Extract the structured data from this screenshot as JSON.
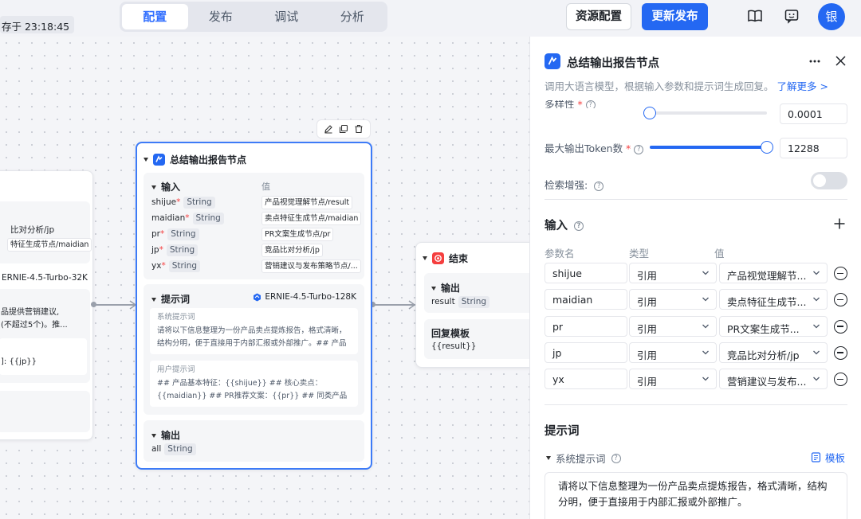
{
  "topbar": {
    "saved_at": "存于 23:18:45",
    "tabs": [
      "配置",
      "发布",
      "调试",
      "分析"
    ],
    "resource_btn": "资源配置",
    "publish_btn": "更新发布",
    "avatar": "银"
  },
  "canvas": {
    "left_node": {
      "lines": [
        "比对分析/jp",
        "特征生成节点/maidian",
        "ERNIE-4.5-Turbo-32K",
        "品提供营销建议,",
        "(不超过5个)。推...",
        "]: {{jp}}"
      ]
    },
    "main_node": {
      "title": "总结输出报告节点",
      "input_title": "输入",
      "value_header": "值",
      "inputs": [
        {
          "name": "shijue",
          "type": "String",
          "value": "产品视觉理解节点/result"
        },
        {
          "name": "maidian",
          "type": "String",
          "value": "卖点特征生成节点/maidian"
        },
        {
          "name": "pr",
          "type": "String",
          "value": "PR文案生成节点/pr"
        },
        {
          "name": "jp",
          "type": "String",
          "value": "竞品比对分析/jp"
        },
        {
          "name": "yx",
          "type": "String",
          "value": "营销建议与发布策略节点/..."
        }
      ],
      "prompt_title": "提示词",
      "model": "ERNIE-4.5-Turbo-128K",
      "system_prompt_label": "系统提示词",
      "system_prompt": "请将以下信息整理为一份产品卖点提炼报告，格式清晰，结构分明，便于直接用于内部汇报或外部推广。## 产品基本...",
      "user_prompt_label": "用户提示词",
      "user_prompt": "## 产品基本特征：{{shijue}} ## 核心卖点：{{maidian}} ## PR推荐文案：{{pr}} ## 同类产品竞品分析：{{jp}} ## 营销...",
      "output_title": "输出",
      "output_name": "all",
      "output_type": "String"
    },
    "end_node": {
      "title": "结束",
      "output_title": "输出",
      "output_name": "result",
      "output_type": "String",
      "reply_title": "回复模板",
      "reply_value": "{{result}}"
    }
  },
  "panel": {
    "title": "总结输出报告节点",
    "description": "调用大语言模型，根据输入参数和提示词生成回复。",
    "learn_more": "了解更多 >",
    "diversity_label": "多样性",
    "diversity_value": "0.0001",
    "diversity_fraction": 0.0,
    "max_token_label": "最大输出Token数",
    "max_token_value": "12288",
    "max_token_fraction": 1.0,
    "retrieval_label": "检索增强:",
    "retrieval_enabled": false,
    "input_section": "输入",
    "col_param": "参数名",
    "col_type": "类型",
    "col_value": "值",
    "params": [
      {
        "name": "shijue",
        "type": "引用",
        "value": "产品视觉理解节..."
      },
      {
        "name": "maidian",
        "type": "引用",
        "value": "卖点特征生成节..."
      },
      {
        "name": "pr",
        "type": "引用",
        "value": "PR文案生成节..."
      },
      {
        "name": "jp",
        "type": "引用",
        "value": "竞品比对分析/jp"
      },
      {
        "name": "yx",
        "type": "引用",
        "value": "营销建议与发布..."
      }
    ],
    "prompt_section": "提示词",
    "system_prompt_label": "系统提示词",
    "template_btn": "模板",
    "system_prompt_text": "请将以下信息整理为一份产品卖点提炼报告，格式清晰，结构分明，便于直接用于内部汇报或外部推广。"
  }
}
